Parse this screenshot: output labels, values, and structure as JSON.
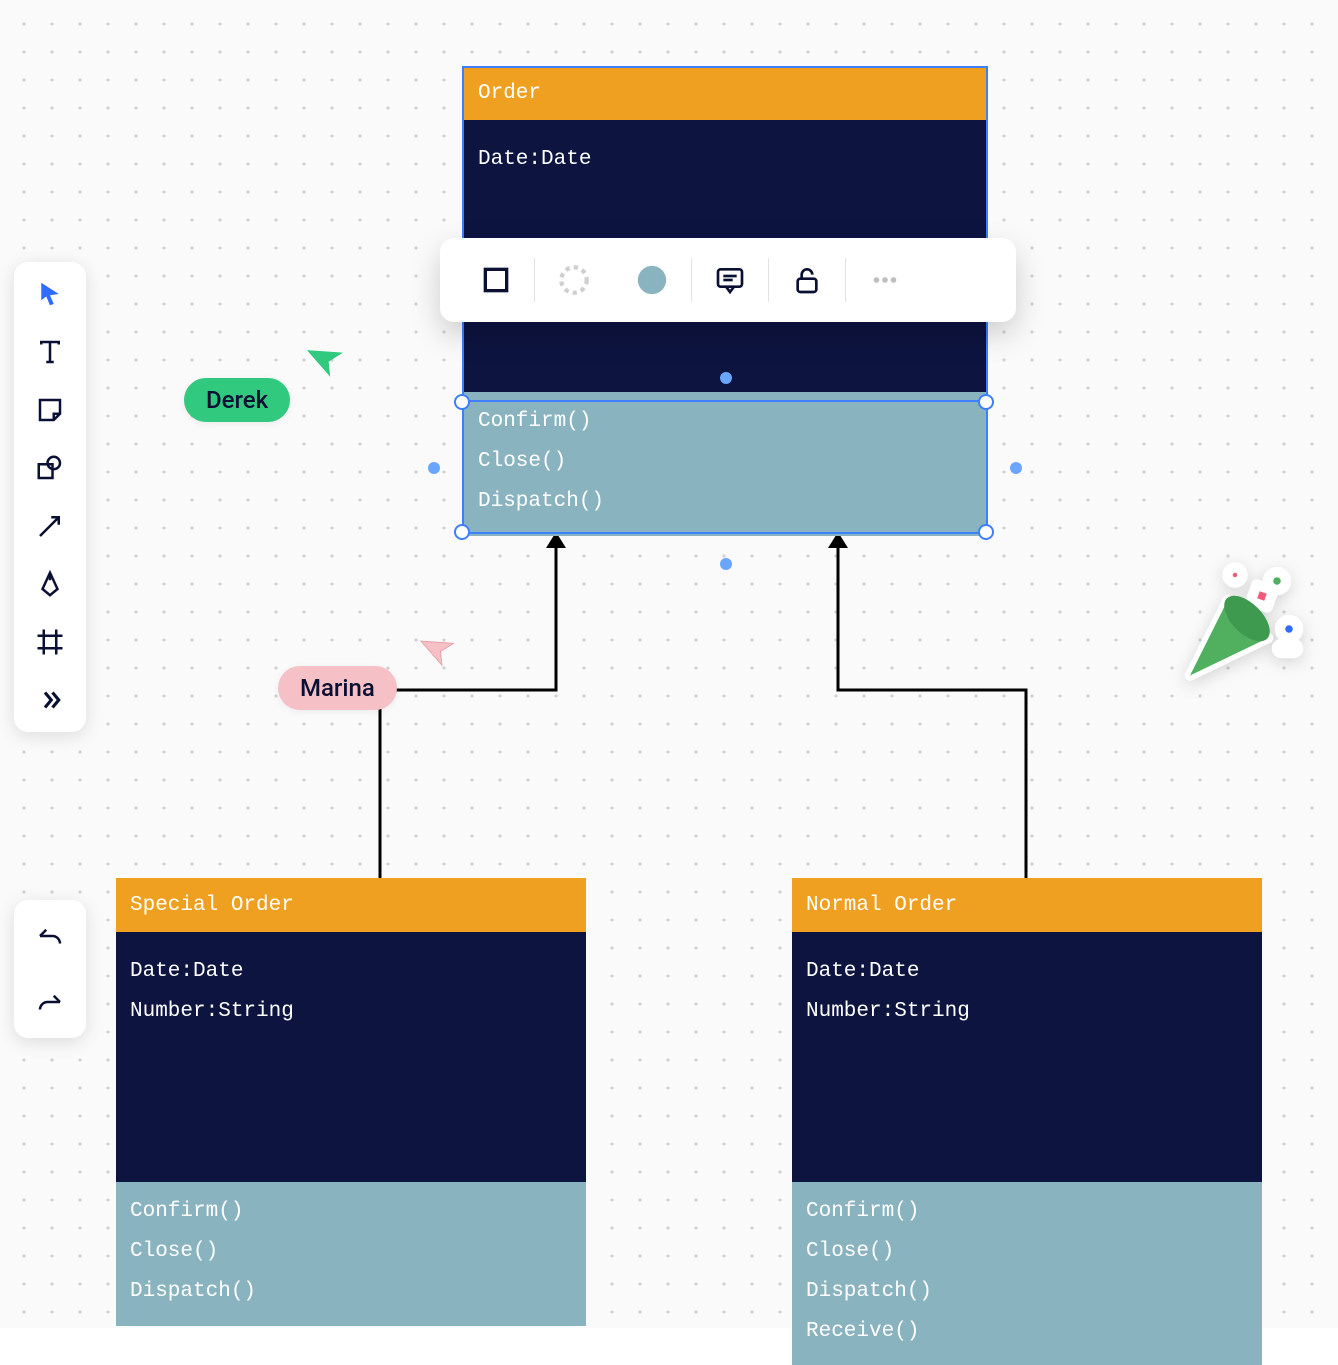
{
  "collaborators": {
    "derek": {
      "name": "Derek",
      "bg": "#30c97e",
      "fg": "#0a1033"
    },
    "marina": {
      "name": "Marina",
      "bg": "#f6c1c6",
      "fg": "#0a1033"
    }
  },
  "classes": {
    "order": {
      "title": "Order",
      "attrs": [
        "Date:Date"
      ],
      "methods": [
        "Confirm()",
        "Close()",
        "Dispatch()"
      ]
    },
    "special": {
      "title": "Special Order",
      "attrs": [
        "Date:Date",
        "Number:String"
      ],
      "methods": [
        "Confirm()",
        "Close()",
        "Dispatch()"
      ]
    },
    "normal": {
      "title": "Normal Order",
      "attrs": [
        "Date:Date",
        "Number:String"
      ],
      "methods": [
        "Confirm()",
        "Close()",
        "Dispatch()",
        "Receive()"
      ]
    }
  },
  "colors": {
    "header": "#f0a020",
    "body": "#0d1440",
    "methods": "#8ab3c0",
    "selection": "#3d7fff",
    "fillSwatch": "#8ab3c0"
  },
  "toolbar": {
    "primary": [
      "select",
      "text",
      "sticky-note",
      "shape",
      "arrow",
      "pen",
      "frame",
      "more"
    ],
    "secondary": [
      "undo",
      "redo"
    ]
  },
  "context_toolbar": [
    "stroke",
    "fill-empty",
    "fill-color",
    "comment",
    "unlock-icon",
    "more-ellipsis"
  ]
}
